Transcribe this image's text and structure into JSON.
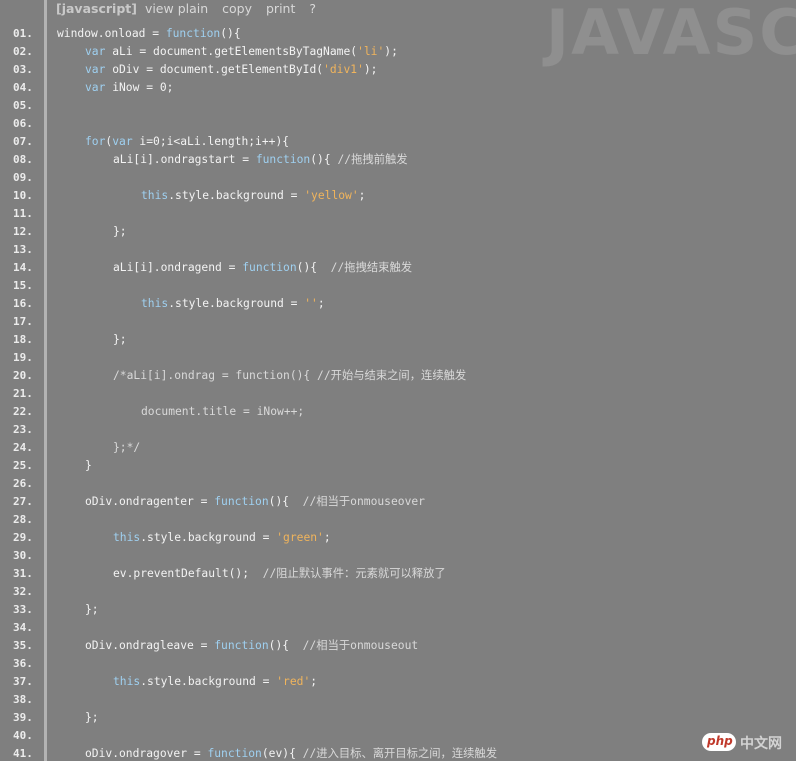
{
  "toolbar": {
    "language_label": "[javascript]",
    "view_plain": "view plain",
    "copy": "copy",
    "print": "print",
    "help": "?"
  },
  "watermark": "JAVASC",
  "colors": {
    "background": "#7f7f7f",
    "gutter_rule": "#b3b3b3",
    "keyword": "#9fd0f0",
    "string": "#f0b45c",
    "text": "#f3f3f3"
  },
  "lines": [
    {
      "num": "01.",
      "indent": 0,
      "tokens": [
        {
          "t": "p",
          "v": "window.onload = "
        },
        {
          "t": "k",
          "v": "function"
        },
        {
          "t": "p",
          "v": "(){"
        }
      ]
    },
    {
      "num": "02.",
      "indent": 1,
      "tokens": [
        {
          "t": "k",
          "v": "var"
        },
        {
          "t": "p",
          "v": " aLi = document.getElementsByTagName("
        },
        {
          "t": "s",
          "v": "'li'"
        },
        {
          "t": "p",
          "v": ");"
        }
      ]
    },
    {
      "num": "03.",
      "indent": 1,
      "tokens": [
        {
          "t": "k",
          "v": "var"
        },
        {
          "t": "p",
          "v": " oDiv = document.getElementById("
        },
        {
          "t": "s",
          "v": "'div1'"
        },
        {
          "t": "p",
          "v": ");"
        }
      ]
    },
    {
      "num": "04.",
      "indent": 1,
      "tokens": [
        {
          "t": "k",
          "v": "var"
        },
        {
          "t": "p",
          "v": " iNow = 0;"
        }
      ]
    },
    {
      "num": "05.",
      "indent": 0,
      "tokens": []
    },
    {
      "num": "06.",
      "indent": 0,
      "tokens": []
    },
    {
      "num": "07.",
      "indent": 1,
      "tokens": [
        {
          "t": "k",
          "v": "for"
        },
        {
          "t": "p",
          "v": "("
        },
        {
          "t": "k",
          "v": "var"
        },
        {
          "t": "p",
          "v": " i=0;i<aLi.length;i++){"
        }
      ]
    },
    {
      "num": "08.",
      "indent": 2,
      "tokens": [
        {
          "t": "p",
          "v": "aLi[i].ondragstart = "
        },
        {
          "t": "k",
          "v": "function"
        },
        {
          "t": "p",
          "v": "(){ "
        },
        {
          "t": "c",
          "v": "//拖拽前触发"
        }
      ]
    },
    {
      "num": "09.",
      "indent": 0,
      "tokens": []
    },
    {
      "num": "10.",
      "indent": 3,
      "tokens": [
        {
          "t": "k",
          "v": "this"
        },
        {
          "t": "p",
          "v": ".style.background = "
        },
        {
          "t": "s",
          "v": "'yellow'"
        },
        {
          "t": "p",
          "v": ";"
        }
      ]
    },
    {
      "num": "11.",
      "indent": 0,
      "tokens": []
    },
    {
      "num": "12.",
      "indent": 2,
      "tokens": [
        {
          "t": "p",
          "v": "};"
        }
      ]
    },
    {
      "num": "13.",
      "indent": 0,
      "tokens": []
    },
    {
      "num": "14.",
      "indent": 2,
      "tokens": [
        {
          "t": "p",
          "v": "aLi[i].ondragend = "
        },
        {
          "t": "k",
          "v": "function"
        },
        {
          "t": "p",
          "v": "(){  "
        },
        {
          "t": "c",
          "v": "//拖拽结束触发"
        }
      ]
    },
    {
      "num": "15.",
      "indent": 0,
      "tokens": []
    },
    {
      "num": "16.",
      "indent": 3,
      "tokens": [
        {
          "t": "k",
          "v": "this"
        },
        {
          "t": "p",
          "v": ".style.background = "
        },
        {
          "t": "s",
          "v": "''"
        },
        {
          "t": "p",
          "v": ";"
        }
      ]
    },
    {
      "num": "17.",
      "indent": 0,
      "tokens": []
    },
    {
      "num": "18.",
      "indent": 2,
      "tokens": [
        {
          "t": "p",
          "v": "};"
        }
      ]
    },
    {
      "num": "19.",
      "indent": 0,
      "tokens": []
    },
    {
      "num": "20.",
      "indent": 2,
      "tokens": [
        {
          "t": "c",
          "v": "/*aLi[i].ondrag = function(){ //开始与结束之间，连续触发"
        }
      ]
    },
    {
      "num": "21.",
      "indent": 0,
      "tokens": []
    },
    {
      "num": "22.",
      "indent": 3,
      "tokens": [
        {
          "t": "c",
          "v": "document.title = iNow++;"
        }
      ]
    },
    {
      "num": "23.",
      "indent": 0,
      "tokens": []
    },
    {
      "num": "24.",
      "indent": 2,
      "tokens": [
        {
          "t": "c",
          "v": "};*/"
        }
      ]
    },
    {
      "num": "25.",
      "indent": 1,
      "tokens": [
        {
          "t": "p",
          "v": "}"
        }
      ]
    },
    {
      "num": "26.",
      "indent": 0,
      "tokens": []
    },
    {
      "num": "27.",
      "indent": 1,
      "tokens": [
        {
          "t": "p",
          "v": "oDiv.ondragenter = "
        },
        {
          "t": "k",
          "v": "function"
        },
        {
          "t": "p",
          "v": "(){  "
        },
        {
          "t": "c",
          "v": "//相当于onmouseover"
        }
      ]
    },
    {
      "num": "28.",
      "indent": 0,
      "tokens": []
    },
    {
      "num": "29.",
      "indent": 2,
      "tokens": [
        {
          "t": "k",
          "v": "this"
        },
        {
          "t": "p",
          "v": ".style.background = "
        },
        {
          "t": "s",
          "v": "'green'"
        },
        {
          "t": "p",
          "v": ";"
        }
      ]
    },
    {
      "num": "30.",
      "indent": 0,
      "tokens": []
    },
    {
      "num": "31.",
      "indent": 2,
      "tokens": [
        {
          "t": "p",
          "v": "ev.preventDefault();  "
        },
        {
          "t": "c",
          "v": "//阻止默认事件：元素就可以释放了"
        }
      ]
    },
    {
      "num": "32.",
      "indent": 0,
      "tokens": []
    },
    {
      "num": "33.",
      "indent": 1,
      "tokens": [
        {
          "t": "p",
          "v": "};"
        }
      ]
    },
    {
      "num": "34.",
      "indent": 0,
      "tokens": []
    },
    {
      "num": "35.",
      "indent": 1,
      "tokens": [
        {
          "t": "p",
          "v": "oDiv.ondragleave = "
        },
        {
          "t": "k",
          "v": "function"
        },
        {
          "t": "p",
          "v": "(){  "
        },
        {
          "t": "c",
          "v": "//相当于onmouseout"
        }
      ]
    },
    {
      "num": "36.",
      "indent": 0,
      "tokens": []
    },
    {
      "num": "37.",
      "indent": 2,
      "tokens": [
        {
          "t": "k",
          "v": "this"
        },
        {
          "t": "p",
          "v": ".style.background = "
        },
        {
          "t": "s",
          "v": "'red'"
        },
        {
          "t": "p",
          "v": ";"
        }
      ]
    },
    {
      "num": "38.",
      "indent": 0,
      "tokens": []
    },
    {
      "num": "39.",
      "indent": 1,
      "tokens": [
        {
          "t": "p",
          "v": "};"
        }
      ]
    },
    {
      "num": "40.",
      "indent": 0,
      "tokens": []
    },
    {
      "num": "41.",
      "indent": 1,
      "tokens": [
        {
          "t": "p",
          "v": "oDiv.ondragover = "
        },
        {
          "t": "k",
          "v": "function"
        },
        {
          "t": "p",
          "v": "(ev){ "
        },
        {
          "t": "c",
          "v": "//进入目标、离开目标之间，连续触发"
        }
      ]
    }
  ],
  "logo": {
    "mark": "php",
    "site": "中文网"
  }
}
